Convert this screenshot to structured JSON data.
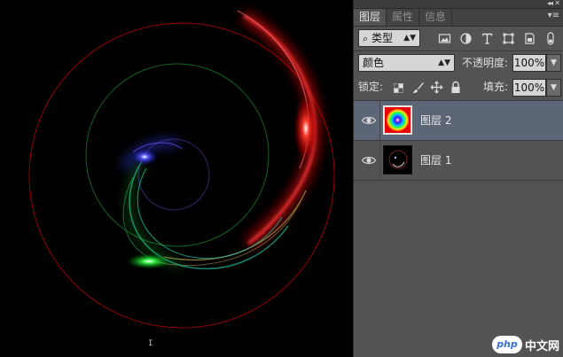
{
  "panel": {
    "tabs": [
      {
        "label": "图层",
        "active": true
      },
      {
        "label": "属性",
        "active": false
      },
      {
        "label": "信息",
        "active": false
      }
    ],
    "filter": {
      "kind_label": "类型"
    },
    "blend_mode": "颜色",
    "opacity_label": "不透明度:",
    "opacity_value": "100%",
    "lock_label": "锁定:",
    "fill_label": "填充:",
    "fill_value": "100%",
    "layers": [
      {
        "name": "图层 2",
        "selected": true,
        "visible": true
      },
      {
        "name": "图层 1",
        "selected": false,
        "visible": true
      }
    ]
  },
  "watermark": {
    "logo_text": "php",
    "site_text": "中文网"
  },
  "icons": [
    "double-chevron-icon",
    "close-icon",
    "panel-menu-icon",
    "search-icon",
    "image-filter-icon",
    "adjustment-filter-icon",
    "type-filter-icon",
    "shape-filter-icon",
    "smart-object-filter-icon",
    "toggle-filter-icon",
    "lock-pixels-icon",
    "lock-paint-icon",
    "lock-move-icon",
    "lock-all-icon",
    "eye-icon"
  ],
  "colors": {
    "accent_red": "#ff1a1a",
    "accent_green": "#22ff44",
    "accent_blue": "#3a4bff",
    "panel_bg": "#535353",
    "selected_layer": "#5d6676"
  }
}
